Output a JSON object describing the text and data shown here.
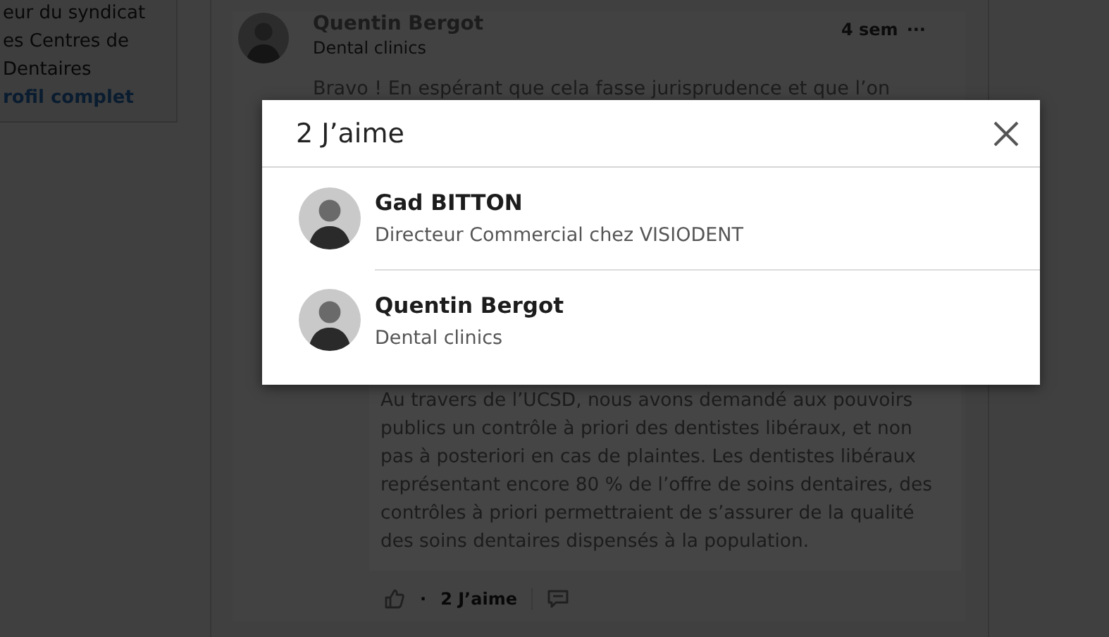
{
  "sidebar_card": {
    "lines": [
      "eur du syndicat",
      "es Centres de",
      "Dentaires"
    ],
    "link": "rofil complet"
  },
  "comment": {
    "author": "Quentin Bergot",
    "headline": "Dental clinics",
    "time": "4 sem",
    "more": "···",
    "text": "Bravo ! En espérant que cela fasse jurisprudence et que l’on",
    "reply_text": "Au travers de l’UCSD, nous avons demandé aux pouvoirs publics un contrôle à priori des dentistes libéraux, et non pas à posteriori en cas de plaintes. Les dentistes libéraux représentant encore 80 % de l’offre de soins dentaires, des contrôles à priori permettraient de s’assurer de la qualité des soins dentaires dispensés à la population.",
    "separator": "·",
    "likes": "2 J’aime"
  },
  "dialog": {
    "title": "2 J’aime",
    "likers": [
      {
        "name": "Gad BITTON",
        "headline": "Directeur Commercial chez VISIODENT"
      },
      {
        "name": "Quentin Bergot",
        "headline": "Dental clinics"
      }
    ]
  }
}
